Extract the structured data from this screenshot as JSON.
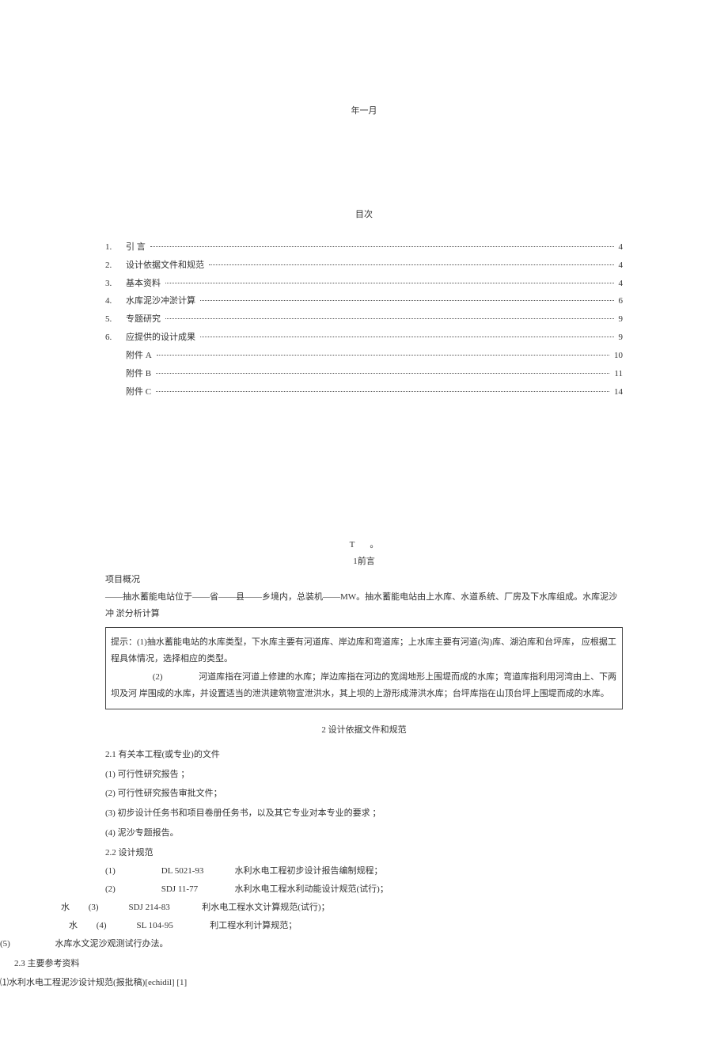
{
  "header_date": "年一月",
  "toc_title": "目次",
  "toc": [
    {
      "num": "1.",
      "label": "引 言",
      "page": "4"
    },
    {
      "num": "2.",
      "label": "设计依据文件和规范",
      "page": "4"
    },
    {
      "num": "3.",
      "label": "基本资料",
      "page": "4"
    },
    {
      "num": "4.",
      "label": "水库泥沙冲淤计算",
      "page": "6"
    },
    {
      "num": "5.",
      "label": "专题研究",
      "page": "9"
    },
    {
      "num": "6.",
      "label": "应提供的设计成果",
      "page": "9"
    },
    {
      "num": "",
      "label": "附件 A",
      "page": "10"
    },
    {
      "num": "",
      "label": "附件 B",
      "page": "11"
    },
    {
      "num": "",
      "label": "附件 C",
      "page": "14"
    }
  ],
  "t_marker": "T",
  "dot_marker": "。",
  "preface_title": "1前言",
  "project_heading": "项目概况",
  "project_para": "——抽水蓄能电站位于——省——县——乡境内，总装机——MW。抽水蓄能电站由上水库、水道系统、厂房及下水库组成。水库泥沙冲 淤分析计算",
  "hint": {
    "p1": "提示：(1)抽水蓄能电站的水库类型，下水库主要有河道库、岸边库和弯道库；上水库主要有河道(沟)库、湖泊库和台坪库，  应根据工程具体情况，选择相应的类型。",
    "p2_num": "(2)",
    "p2": "河道库指在河道上修建的水库；岸边库指在河边的宽阔地形上围堤而成的水库；弯道库指利用河湾由上、下两坝及河 岸围成的水库，并设置适当的泄洪建筑物宣泄洪水，其上坝的上游形成滞洪水库；台坪库指在山顶台坪上围堤而成的水库。"
  },
  "sec2_title": "2    设计依据文件和规范",
  "s2_1": "2.1  有关本工程(或专业)的文件",
  "s2_1_items": [
    "(1)  可行性研究报告 ；",
    "(2)  可行性研究报告审批文件；",
    "(3)  初步设计任务书和项目卷册任务书，以及其它专业对本专业的要求 ；",
    "(4)  泥沙专题报告。"
  ],
  "s2_2": "2.2  设计规范",
  "standards": [
    {
      "idx": "(1)",
      "code": "DL 5021-93",
      "desc": "水利水电工程初步设计报告编制规程；"
    },
    {
      "idx": "(2)",
      "code": "SDJ 11-77",
      "desc": "水利水电工程水利动能设计规范(试行)；"
    },
    {
      "idx": "(3)",
      "code": "SDJ 214-83",
      "desc": "利水电工程水文计算规范(试行)；"
    },
    {
      "idx": "(4)",
      "code": "SL 104-95",
      "desc": "利工程水利计算规范；"
    }
  ],
  "std_prefix_3": "水",
  "std_prefix_4": "水",
  "s2_2_5_num": "(5)",
  "s2_2_5": "水库水文泥沙观测试行办法。",
  "s2_3": "2.3  主要参考资料",
  "s2_3_1": "⑴水利水电工程泥沙设计规范(报批稿)",
  "ref_tag": "[echidil] [1]"
}
